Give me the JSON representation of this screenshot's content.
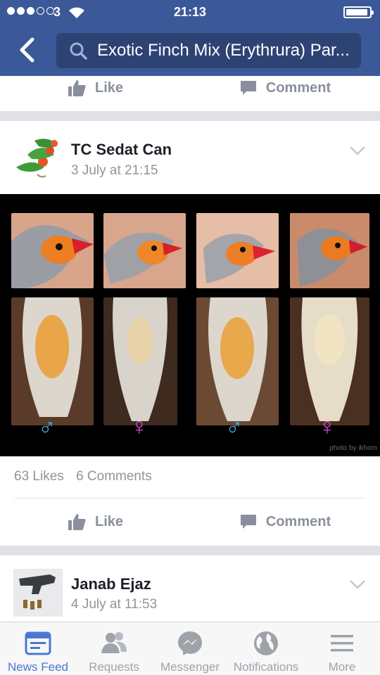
{
  "status_bar": {
    "carrier": "3",
    "time": "21:13"
  },
  "nav": {
    "search_text": "Exotic Finch Mix (Erythrura) Par..."
  },
  "prev_post": {
    "like_label": "Like",
    "comment_label": "Comment"
  },
  "post": {
    "author": "TC Sedat Can",
    "date": "3 July at 21:15",
    "photo_credit": "photo by ikhom",
    "sex_symbols": [
      "♂",
      "♀",
      "♂",
      "♀"
    ],
    "likes": "63 Likes",
    "comments": "6 Comments",
    "like_label": "Like",
    "comment_label": "Comment"
  },
  "next_post": {
    "author": "Janab Ejaz",
    "date": "4 July at 11:53"
  },
  "tabbar": {
    "items": [
      {
        "label": "News Feed",
        "icon": "news-feed-icon",
        "active": true
      },
      {
        "label": "Requests",
        "icon": "requests-icon"
      },
      {
        "label": "Messenger",
        "icon": "messenger-icon"
      },
      {
        "label": "Notifications",
        "icon": "globe-icon"
      },
      {
        "label": "More",
        "icon": "menu-icon"
      }
    ]
  },
  "colors": {
    "brand": "#3b5998",
    "active_tab": "#4a78d1",
    "male": "#4aaee8",
    "female": "#d64fd6"
  }
}
